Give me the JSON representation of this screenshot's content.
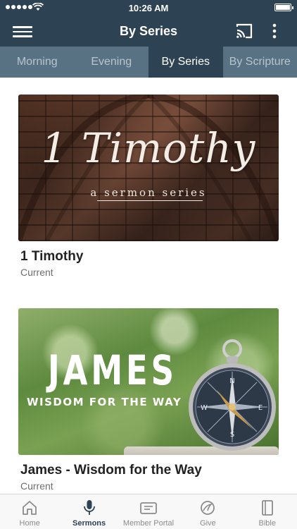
{
  "status_bar": {
    "time": "10:26 AM"
  },
  "nav": {
    "title": "By Series",
    "menu_icon": "hamburger-menu-icon",
    "cast_icon": "cast-icon",
    "more_icon": "more-vertical-icon"
  },
  "tabs": [
    {
      "label": "Morning",
      "active": false
    },
    {
      "label": "Evening",
      "active": false
    },
    {
      "label": "By Series",
      "active": true
    },
    {
      "label": "By Scripture",
      "active": false
    }
  ],
  "series": [
    {
      "title": "1 Timothy",
      "status": "Current",
      "artwork": {
        "title": "1 Timothy",
        "subtitle": "a sermon series"
      }
    },
    {
      "title": "James - Wisdom for the Way",
      "status": "Current",
      "artwork": {
        "title": "JAMES",
        "subtitle": "WISDOM FOR THE WAY"
      }
    }
  ],
  "bottom_nav": [
    {
      "label": "Home",
      "icon": "home-icon",
      "active": false
    },
    {
      "label": "Sermons",
      "icon": "microphone-icon",
      "active": true
    },
    {
      "label": "Member Portal",
      "icon": "id-card-icon",
      "active": false
    },
    {
      "label": "Give",
      "icon": "give-hand-icon",
      "active": false
    },
    {
      "label": "Bible",
      "icon": "book-icon",
      "active": false
    }
  ],
  "colors": {
    "header": "#2d4253",
    "tabs_bg": "#587183",
    "tab_inactive_text": "#b7c5cf",
    "active_nav": "#2d4253"
  }
}
